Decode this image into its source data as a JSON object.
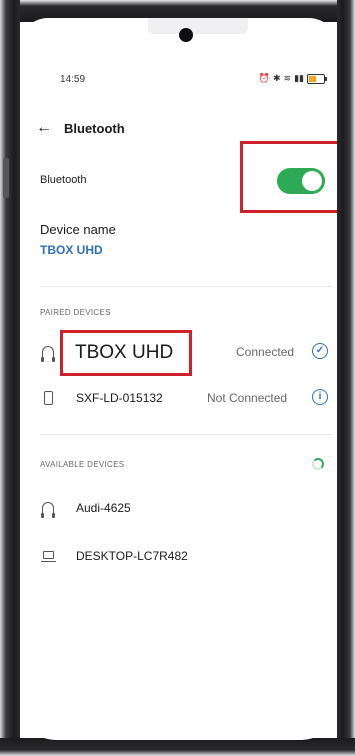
{
  "status_bar": {
    "time": "14:59",
    "icons": [
      "alarm-icon",
      "bluetooth-icon",
      "wifi-icon",
      "signal-icon",
      "battery-icon"
    ]
  },
  "header": {
    "title": "Bluetooth"
  },
  "bluetooth_toggle": {
    "label": "Bluetooth",
    "on": true
  },
  "device_name": {
    "label": "Device name",
    "value": "TBOX UHD"
  },
  "paired": {
    "header": "PAIRED DEVICES",
    "devices": [
      {
        "name": "TBOX UHD",
        "status": "Connected",
        "icon": "headphone-icon",
        "action_icon": "check-icon"
      },
      {
        "name": "SXF-LD-015132",
        "status": "Not Connected",
        "icon": "phone-icon",
        "action_icon": "info-icon"
      }
    ]
  },
  "available": {
    "header": "AVAILABLE DEVICES",
    "scanning": true,
    "devices": [
      {
        "name": "Audi-4625",
        "icon": "headphone-icon"
      },
      {
        "name": "DESKTOP-LC7R482",
        "icon": "laptop-icon"
      }
    ]
  },
  "colors": {
    "accent": "#2f6fb3",
    "toggle_on": "#2eaa56",
    "highlight": "#d0202a"
  }
}
